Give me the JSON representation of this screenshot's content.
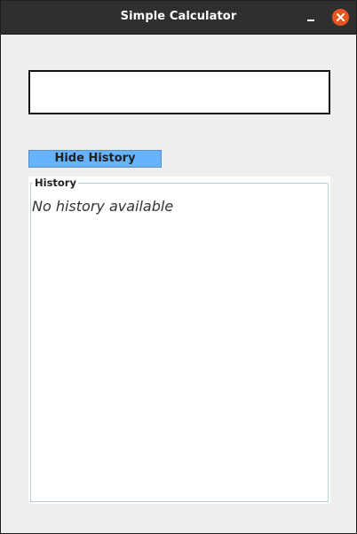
{
  "window": {
    "title": "Simple Calculator"
  },
  "display": {
    "value": ""
  },
  "history_toggle": {
    "label": "Hide History"
  },
  "history": {
    "legend": "History",
    "empty_message": "No history available",
    "items": []
  },
  "colors": {
    "titlebar": "#2f2f2f",
    "close_button": "#e95420",
    "toggle_button": "#66b3ff",
    "window_bg": "#eeeeee"
  },
  "icons": {
    "minimize": "minimize-icon",
    "close": "close-icon"
  }
}
